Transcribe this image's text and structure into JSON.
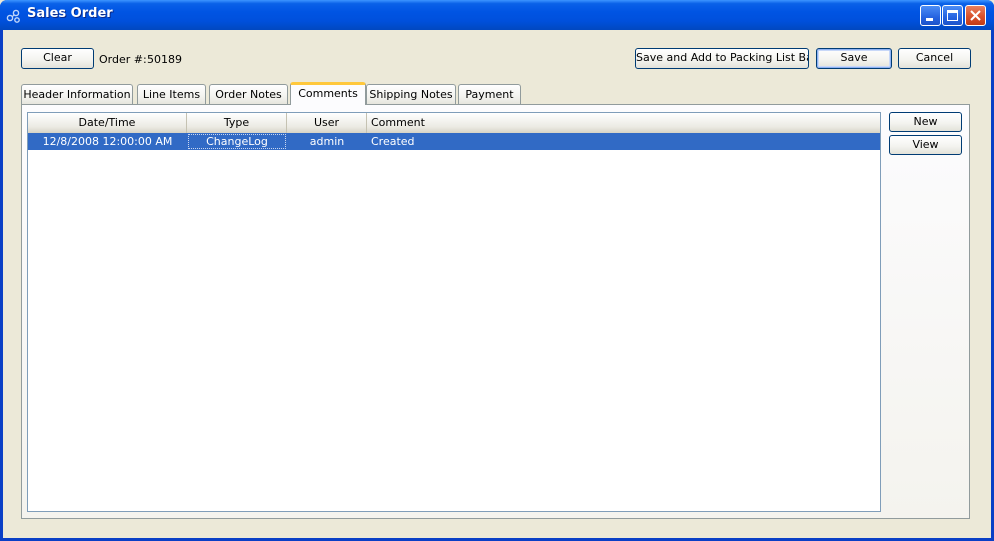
{
  "window": {
    "title": "Sales Order",
    "controls": [
      "minimize-icon",
      "maximize-icon",
      "close-icon"
    ]
  },
  "toolbar": {
    "clear_label": "Clear",
    "order_label": "Order #:",
    "order_number": "50189",
    "save_add_batch_label": "Save and Add to Packing List Batch",
    "save_label": "Save",
    "cancel_label": "Cancel"
  },
  "tabs": [
    {
      "label": "Header Information"
    },
    {
      "label": "Line Items"
    },
    {
      "label": "Order Notes"
    },
    {
      "label": "Comments",
      "active": true
    },
    {
      "label": "Shipping Notes"
    },
    {
      "label": "Payment"
    }
  ],
  "comments": {
    "columns": [
      "Date/Time",
      "Type",
      "User",
      "Comment"
    ],
    "rows": [
      {
        "datetime": "12/8/2008 12:00:00 AM",
        "type": "ChangeLog",
        "user": "admin",
        "comment": "Created",
        "selected": true
      }
    ],
    "new_label": "New",
    "view_label": "View"
  },
  "colors": {
    "title_bar": "#0054E3",
    "selection": "#316AC5",
    "active_tab_accent": "#FFC83C",
    "window_bg": "#ECE9D8"
  }
}
